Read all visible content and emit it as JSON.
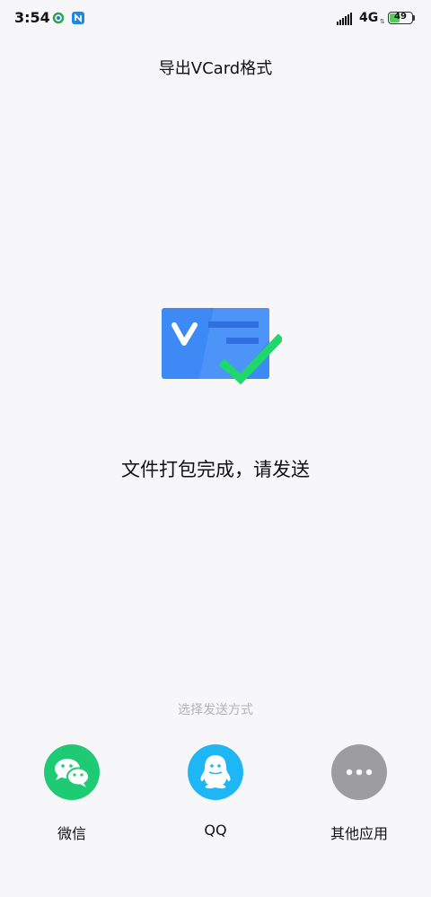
{
  "status_bar": {
    "time": "3:54",
    "network": "4G",
    "network_arrows": "⇅",
    "battery_level": "49",
    "battery_fraction": 0.49,
    "app_icons": [
      "sync-app-icon",
      "n-app-icon"
    ]
  },
  "header": {
    "title": "导出VCard格式"
  },
  "main": {
    "illustration": "vcard-check-icon",
    "status_text": "文件打包完成，请发送"
  },
  "share": {
    "prompt": "选择发送方式",
    "options": [
      {
        "label": "微信",
        "icon": "wechat-icon",
        "color": "#1ecb74"
      },
      {
        "label": "QQ",
        "icon": "qq-icon",
        "color": "#1fb6f5"
      },
      {
        "label": "其他应用",
        "icon": "more-icon",
        "color": "#9d9d9f"
      }
    ]
  },
  "colors": {
    "card_blue": "#3d8af7",
    "check_green": "#1fd76b",
    "background": "#f7f7f9"
  }
}
